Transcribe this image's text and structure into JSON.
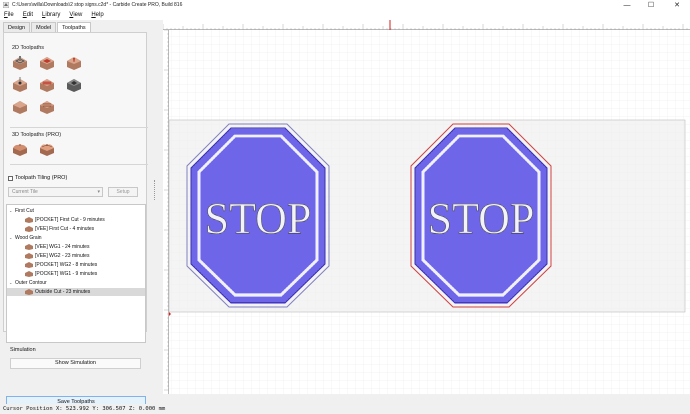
{
  "window": {
    "title": "C:\\Users\\willa\\Downloads\\2 stop signs.c2d* - Carbide Create PRO, Build 816",
    "minimize_glyph": "—",
    "maximize_glyph": "☐",
    "close_glyph": "✕"
  },
  "menu": {
    "file_u": "F",
    "file_rest": "ile",
    "edit_u": "E",
    "edit_rest": "dit",
    "library_u": "L",
    "library_rest": "ibrary",
    "view_u": "V",
    "view_rest": "iew",
    "help_u": "H",
    "help_rest": "elp"
  },
  "tabs": {
    "design": "Design",
    "model": "Model",
    "toolpaths": "Toolpaths",
    "active": "toolpaths"
  },
  "toolpaths_panel": {
    "section_2d": "2D Toolpaths",
    "section_3d": "3D Toolpaths (PRO)",
    "tiling_label": "Toolpath Tiling (PRO)",
    "tiling_checked": false,
    "tile_select_value": "Current Tile",
    "setup_label": "Setup"
  },
  "toolpath_tree": {
    "groups": [
      {
        "name": "First Cut",
        "items": [
          "[POCKET] First Cut - 9 minutes",
          "[VEE] First Cut - 4 minutes"
        ]
      },
      {
        "name": "Wood Grain",
        "items": [
          "[VEE] WG1 - 24 minutes",
          "[VEE] WG2 - 23 minutes",
          "[POCKET] WG2 - 8 minutes",
          "[POCKET] WG1 - 9 minutes"
        ]
      },
      {
        "name": "Outer Contour",
        "items": [
          "Outside Cut - 23 minutes"
        ]
      }
    ],
    "selected": "Outside Cut - 23 minutes"
  },
  "simulation": {
    "label": "Simulation",
    "button": "Show Simulation"
  },
  "save_button": "Save Toolpaths",
  "canvas": {
    "sign_text_left": "STOP",
    "sign_text_right": "STOP",
    "sign_fill_color": "#4b3fe0",
    "sign_line_color": "#d8d8ff",
    "right_contour_color": "#d04040",
    "left_contour_color": "#8080c0"
  },
  "status": {
    "cursor_position": "Cursor Position X: 523.992 Y: 306.507 Z: 0.000 mm"
  }
}
